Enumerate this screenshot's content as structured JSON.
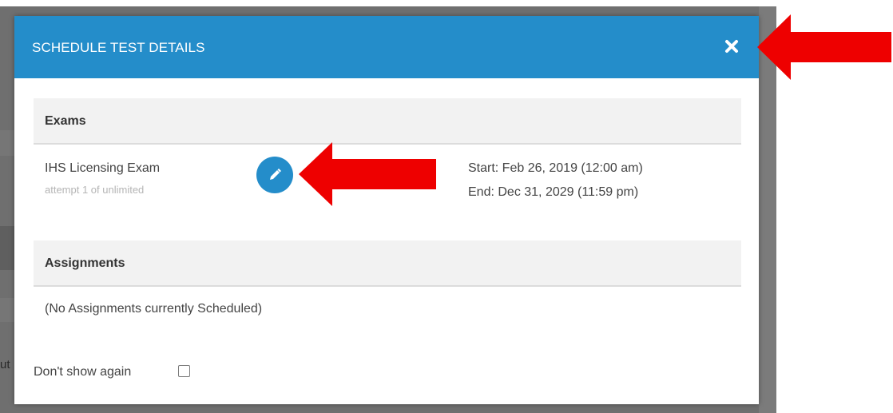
{
  "modal": {
    "title": "SCHEDULE TEST DETAILS",
    "close_icon": "close-icon",
    "header_color": "#248dca"
  },
  "exams": {
    "section_label": "Exams",
    "items": [
      {
        "name": "IHS Licensing Exam",
        "attempt": "attempt 1 of unlimited",
        "start": "Start: Feb 26, 2019 (12:00 am)",
        "end": "End: Dec 31, 2029 (11:59 pm)",
        "edit_icon": "pencil-icon"
      }
    ]
  },
  "assignments": {
    "section_label": "Assignments",
    "empty_text": "(No Assignments currently Scheduled)"
  },
  "footer": {
    "dont_show_label": "Don't show again",
    "dont_show_checked": false
  },
  "background": {
    "partial_text": "ut"
  },
  "annotations": {
    "arrow_color": "#ee0000",
    "arrows": [
      "arrow-to-close-icon",
      "arrow-to-edit-button"
    ]
  }
}
